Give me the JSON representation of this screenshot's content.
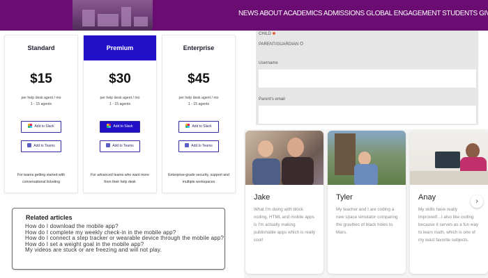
{
  "header": {
    "nav_text": "NEWS ABOUT ACADEMICS ADMISSIONS GLOBAL ENGAGEMENT STUDENTS GIVING EVENTS",
    "brand_color": "#6a0c72"
  },
  "pricing": {
    "accent_color": "#2110c8",
    "plans": [
      {
        "name": "Standard",
        "price": "$15",
        "per": "per help desk agent / mo",
        "agents": "1 - 15 agents",
        "slack": "Add to Slack",
        "teams": "Add to Teams",
        "desc": "For teams getting started with conversational ticketing"
      },
      {
        "name": "Premium",
        "price": "$30",
        "per": "per help desk agent / mo",
        "agents": "1 - 15 agents",
        "slack": "Add to Slack",
        "teams": "Add to Teams",
        "desc": "For advanced teams who want more from their help desk"
      },
      {
        "name": "Enterprise",
        "price": "$45",
        "per": "per help desk agent / mo",
        "agents": "1 - 15 agents",
        "slack": "Add to Slack",
        "teams": "Add to Teams",
        "desc": "Enterprise-grade security, support and multiple workspaces"
      }
    ]
  },
  "related": {
    "title": "Related articles",
    "items": [
      "How do I download the mobile app?",
      "How do I complete my weekly check-in in the mobile app?",
      "How do I connect a step tracker or wearable device through the mobile app?",
      "How do I set a weight goal in the mobile app?",
      "My videos are stuck or are freezing and will not play."
    ]
  },
  "form": {
    "child_label": "CHILD",
    "parent_label": "PARENT/GUARDIAN",
    "username_label": "Username",
    "email_label": "Parent's email"
  },
  "students": [
    {
      "name": "Jake",
      "quote": "What I'm doing with block coding, HTML and mobile apps is I'm actually making publishable apps which is really cool!"
    },
    {
      "name": "Tyler",
      "quote": "My teacher and I are coding a new space simulator comparing the gravities of black holes to Mars."
    },
    {
      "name": "Anay",
      "quote": "My skills have really improved!...I also like coding because it serves as a fun way to learn math, which is one of my least favorite subjects."
    }
  ],
  "carousel": {
    "next_icon": "chevron-right-icon",
    "next_glyph": "›"
  }
}
